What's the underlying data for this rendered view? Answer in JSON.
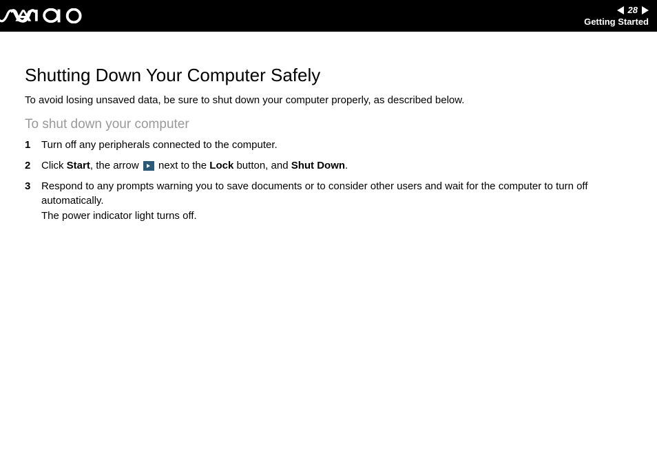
{
  "header": {
    "page_number": "28",
    "section": "Getting Started"
  },
  "content": {
    "title": "Shutting Down Your Computer Safely",
    "intro": "To avoid losing unsaved data, be sure to shut down your computer properly, as described below.",
    "subsection_title": "To shut down your computer",
    "steps": [
      {
        "number": "1",
        "text": "Turn off any peripherals connected to the computer."
      },
      {
        "number": "2",
        "prefix": "Click ",
        "bold1": "Start",
        "mid1": ", the arrow ",
        "mid2": " next to the ",
        "bold2": "Lock",
        "mid3": " button, and ",
        "bold3": "Shut Down",
        "suffix": "."
      },
      {
        "number": "3",
        "line1": "Respond to any prompts warning you to save documents or to consider other users and wait for the computer to turn off automatically.",
        "line2": "The power indicator light turns off."
      }
    ]
  }
}
